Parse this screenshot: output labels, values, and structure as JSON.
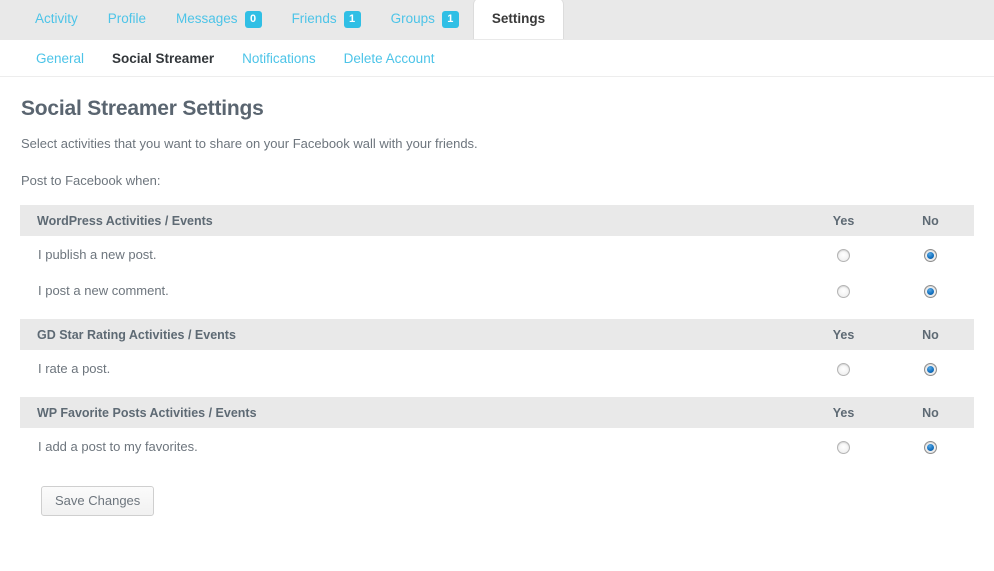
{
  "nav": {
    "tabs": [
      {
        "label": "Activity",
        "badge": null,
        "active": false
      },
      {
        "label": "Profile",
        "badge": null,
        "active": false
      },
      {
        "label": "Messages",
        "badge": "0",
        "active": false
      },
      {
        "label": "Friends",
        "badge": "1",
        "active": false
      },
      {
        "label": "Groups",
        "badge": "1",
        "active": false
      },
      {
        "label": "Settings",
        "badge": null,
        "active": true
      }
    ]
  },
  "subnav": {
    "items": [
      {
        "label": "General",
        "active": false
      },
      {
        "label": "Social Streamer",
        "active": true
      },
      {
        "label": "Notifications",
        "active": false
      },
      {
        "label": "Delete Account",
        "active": false
      }
    ]
  },
  "main": {
    "title": "Social Streamer Settings",
    "intro": "Select activities that you want to share on your Facebook wall with your friends.",
    "subintro": "Post to Facebook when:",
    "yes_label": "Yes",
    "no_label": "No",
    "sections": [
      {
        "header": "WordPress Activities / Events",
        "rows": [
          {
            "label": "I publish a new post.",
            "value": "no"
          },
          {
            "label": "I post a new comment.",
            "value": "no"
          }
        ]
      },
      {
        "header": "GD Star Rating Activities / Events",
        "rows": [
          {
            "label": "I rate a post.",
            "value": "no"
          }
        ]
      },
      {
        "header": "WP Favorite Posts Activities / Events",
        "rows": [
          {
            "label": "I add a post to my favorites.",
            "value": "no"
          }
        ]
      }
    ]
  },
  "footer": {
    "save_label": "Save Changes"
  },
  "colors": {
    "accent": "#4dc4e8",
    "badge": "#30bfe5",
    "header_bg": "#e9e9e9",
    "text": "#6d757d",
    "radio_selected": "#1574c4"
  }
}
